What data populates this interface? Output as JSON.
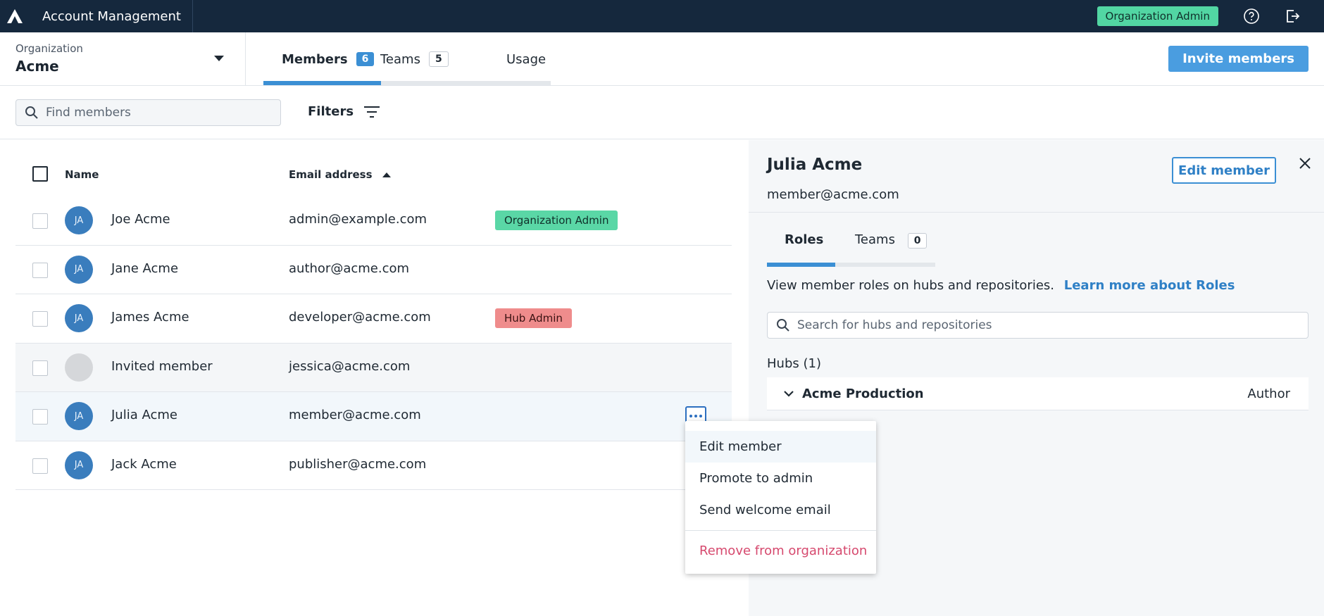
{
  "app": {
    "title": "Account Management",
    "role_badge": "Organization Admin"
  },
  "org": {
    "label": "Organization",
    "name": "Acme"
  },
  "tabs": [
    {
      "label": "Members",
      "count": "6"
    },
    {
      "label": "Teams",
      "count": "5"
    },
    {
      "label": "Usage"
    }
  ],
  "actions": {
    "invite": "Invite members"
  },
  "search": {
    "placeholder": "Find members",
    "filters_label": "Filters"
  },
  "table": {
    "columns": {
      "name": "Name",
      "email": "Email address"
    },
    "rows": [
      {
        "initials": "JA",
        "name": "Joe Acme",
        "email": "admin@example.com",
        "badge": "Organization Admin"
      },
      {
        "initials": "JA",
        "name": "Jane Acme",
        "email": "author@acme.com",
        "badge": ""
      },
      {
        "initials": "JA",
        "name": "James Acme",
        "email": "developer@acme.com",
        "badge": "Hub Admin"
      },
      {
        "initials": "",
        "name": "Invited member",
        "email": "jessica@acme.com",
        "badge": ""
      },
      {
        "initials": "JA",
        "name": "Julia Acme",
        "email": "member@acme.com",
        "badge": ""
      },
      {
        "initials": "JA",
        "name": "Jack Acme",
        "email": "publisher@acme.com",
        "badge": ""
      }
    ]
  },
  "menu": {
    "items": [
      "Edit member",
      "Promote to admin",
      "Send welcome email"
    ],
    "danger": "Remove from organization"
  },
  "panel": {
    "name": "Julia Acme",
    "email": "member@acme.com",
    "edit_label": "Edit member",
    "tabs": [
      {
        "label": "Roles"
      },
      {
        "label": "Teams",
        "count": "0"
      }
    ],
    "description": "View member roles on hubs and repositories.",
    "learn_more": "Learn more about Roles",
    "search_placeholder": "Search for hubs and repositories",
    "hubs_label": "Hubs (1)",
    "hub": {
      "name": "Acme Production",
      "role": "Author"
    }
  },
  "colors": {
    "topbar": "#15283d",
    "accent": "#3b8fd4",
    "org_admin": "#5ad7a6",
    "hub_admin": "#ef8c8c",
    "danger": "#d6496e"
  }
}
